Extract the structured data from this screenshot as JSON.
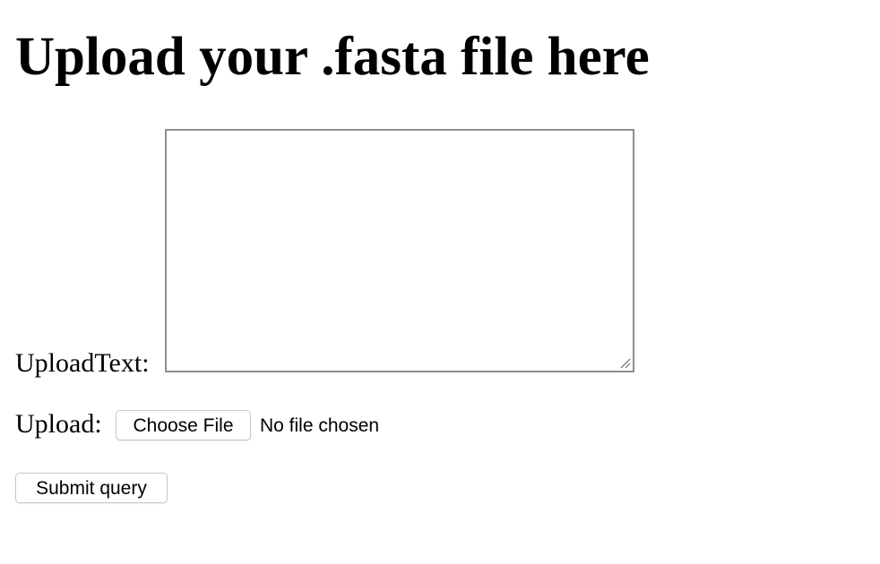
{
  "page": {
    "title": "Upload your .fasta file here"
  },
  "form": {
    "text_label": "UploadText:",
    "text_value": "",
    "file_label": "Upload:",
    "choose_file_label": "Choose File",
    "file_status": "No file chosen",
    "submit_label": "Submit query"
  },
  "icons": {
    "resize_grip": "resize-grip-icon"
  },
  "colors": {
    "background": "#ffffff",
    "text": "#000000",
    "textarea_border": "#8e8e8e",
    "button_border": "#c8c8c8"
  }
}
